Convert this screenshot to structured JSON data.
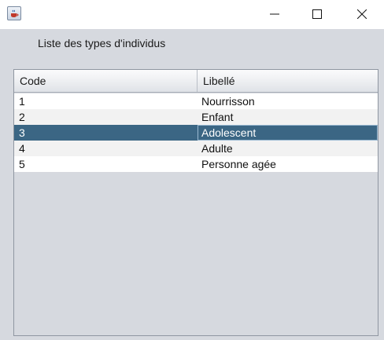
{
  "window": {
    "icons": {
      "app": "java-cup-icon",
      "minimize": "minimize-icon",
      "maximize": "maximize-icon",
      "close": "close-icon"
    }
  },
  "heading": "Liste des types d'individus",
  "table": {
    "columns": [
      "Code",
      "Libellé"
    ],
    "rows": [
      {
        "code": "1",
        "libelle": "Nourrisson"
      },
      {
        "code": "2",
        "libelle": "Enfant"
      },
      {
        "code": "3",
        "libelle": "Adolescent"
      },
      {
        "code": "4",
        "libelle": "Adulte"
      },
      {
        "code": "5",
        "libelle": "Personne agée"
      }
    ],
    "selected_row": 2
  },
  "colors": {
    "window_background": "#d6d9df",
    "selection": "#3b6684",
    "selection_text": "#ffffff",
    "alternate_row": "#f2f2f2"
  }
}
